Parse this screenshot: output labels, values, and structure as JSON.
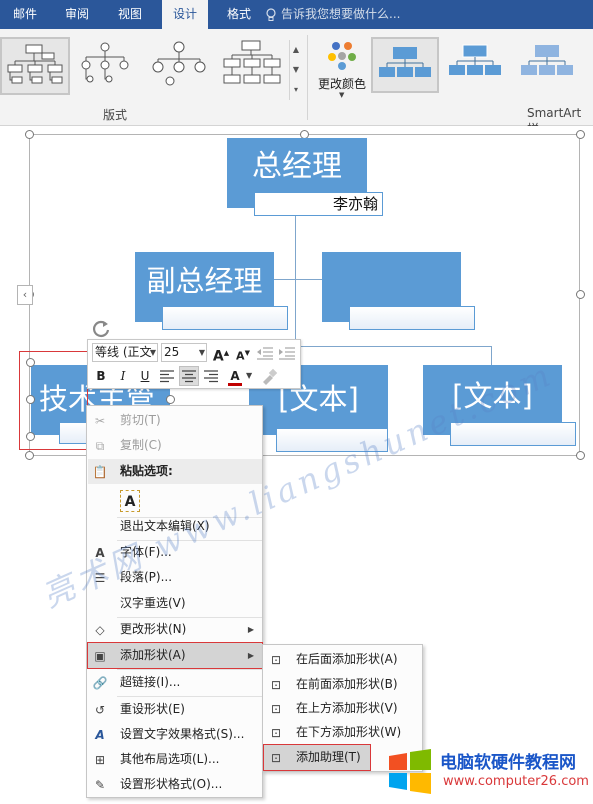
{
  "ribbon": {
    "tabs": [
      {
        "label": "邮件",
        "active": false
      },
      {
        "label": "审阅",
        "active": false
      },
      {
        "label": "视图",
        "active": false
      },
      {
        "label": "设计",
        "active": true
      },
      {
        "label": "格式",
        "active": false
      }
    ],
    "tell_me": "告诉我您想要做什么...",
    "group_layouts": "版式",
    "change_colors": "更改颜色",
    "group_smartart_styles": "SmartArt 样",
    "accent_color": "#2b579a"
  },
  "smartart": {
    "top_node": "总经理",
    "top_sub": "李亦翰",
    "vp_node": "副总经理",
    "tech_node": "技术主管",
    "text_placeholder": "[文本]",
    "node_color": "#5b9bd5"
  },
  "minibar": {
    "font_name": "等线 (正文",
    "font_size": "25",
    "grow_font": "A",
    "shrink_font": "A",
    "bold": "B",
    "italic": "I",
    "underline": "U",
    "font_color": "A"
  },
  "context_menu": {
    "items": [
      {
        "label": "剪切(T)",
        "icon": "scissors-icon",
        "disabled": true
      },
      {
        "label": "复制(C)",
        "icon": "copy-icon",
        "disabled": true
      },
      {
        "label": "粘贴选项:",
        "icon": "paste-icon",
        "section": true
      },
      {
        "label": "A",
        "icon": "paste-keep-text-icon"
      },
      {
        "label": "退出文本编辑(X)",
        "icon": ""
      },
      {
        "label": "字体(F)...",
        "icon": "font-icon"
      },
      {
        "label": "段落(P)...",
        "icon": "paragraph-icon"
      },
      {
        "label": "汉字重选(V)",
        "icon": ""
      },
      {
        "label": "更改形状(N)",
        "icon": "change-shape-icon",
        "submenu": true
      },
      {
        "label": "添加形状(A)",
        "icon": "add-shape-icon",
        "submenu": true,
        "highlighted": true
      },
      {
        "label": "超链接(I)...",
        "icon": "hyperlink-icon"
      },
      {
        "label": "重设形状(E)",
        "icon": "reset-shape-icon"
      },
      {
        "label": "设置文字效果格式(S)...",
        "icon": "text-effects-icon"
      },
      {
        "label": "其他布局选项(L)...",
        "icon": "layout-options-icon"
      },
      {
        "label": "设置形状格式(O)...",
        "icon": "format-shape-icon"
      }
    ]
  },
  "submenu": {
    "items": [
      {
        "label": "在后面添加形状(A)",
        "icon": "add-after-icon"
      },
      {
        "label": "在前面添加形状(B)",
        "icon": "add-before-icon"
      },
      {
        "label": "在上方添加形状(V)",
        "icon": "add-above-icon"
      },
      {
        "label": "在下方添加形状(W)",
        "icon": "add-below-icon"
      },
      {
        "label": "添加助理(T)",
        "icon": "add-assistant-icon",
        "highlighted": true
      }
    ]
  },
  "watermarks": {
    "diagonal": "亮术网 www.liangshunet.com",
    "site_title": "电脑软硬件教程网",
    "site_url": "www.computer26.com"
  },
  "colors": {
    "highlight_outline": "#d9383a",
    "menu_hover": "#d4d4d4"
  }
}
